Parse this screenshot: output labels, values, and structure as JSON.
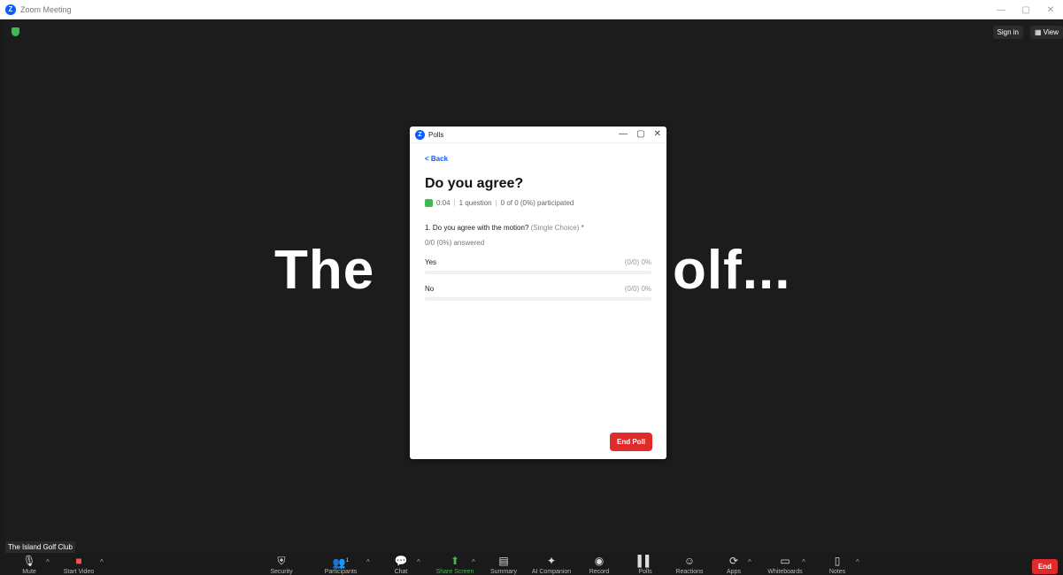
{
  "app": {
    "title": "Zoom Meeting",
    "logo_letter": "Z"
  },
  "window_controls": {
    "minimize": "—",
    "restore": "▢",
    "close": "✕"
  },
  "top_right": {
    "sign_in": "Sign in",
    "view": "View"
  },
  "shared_screen": {
    "text_left": "The",
    "text_right": "olf..."
  },
  "participant_name": "The Island Golf Club",
  "toolbar": {
    "mute": "Mute",
    "start_video": "Start Video",
    "security": "Security",
    "participants": "Participants",
    "participants_count": "1",
    "chat": "Chat",
    "share_screen": "Share Screen",
    "summary": "Summary",
    "ai_companion": "AI Companion",
    "record": "Record",
    "polls": "Polls",
    "reactions": "Reactions",
    "apps": "Apps",
    "whiteboards": "Whiteboards",
    "notes": "Notes",
    "end": "End"
  },
  "polls": {
    "window_title": "Polls",
    "back": "< Back",
    "title": "Do you agree?",
    "timer": "0:04",
    "questions": "1 question",
    "participated": "0 of 0 (0%) participated",
    "question": "1. Do you agree with the motion?",
    "question_type": "(Single Choice)",
    "required_mark": "*",
    "answered": "0/0 (0%) answered",
    "options": [
      {
        "label": "Yes",
        "value": "(0/0) 0%",
        "fraction": 0
      },
      {
        "label": "No",
        "value": "(0/0) 0%",
        "fraction": 0
      }
    ],
    "end_poll": "End Poll"
  },
  "colors": {
    "accent": "#0b5cff",
    "danger": "#e02b2b",
    "success": "#3fb950"
  }
}
